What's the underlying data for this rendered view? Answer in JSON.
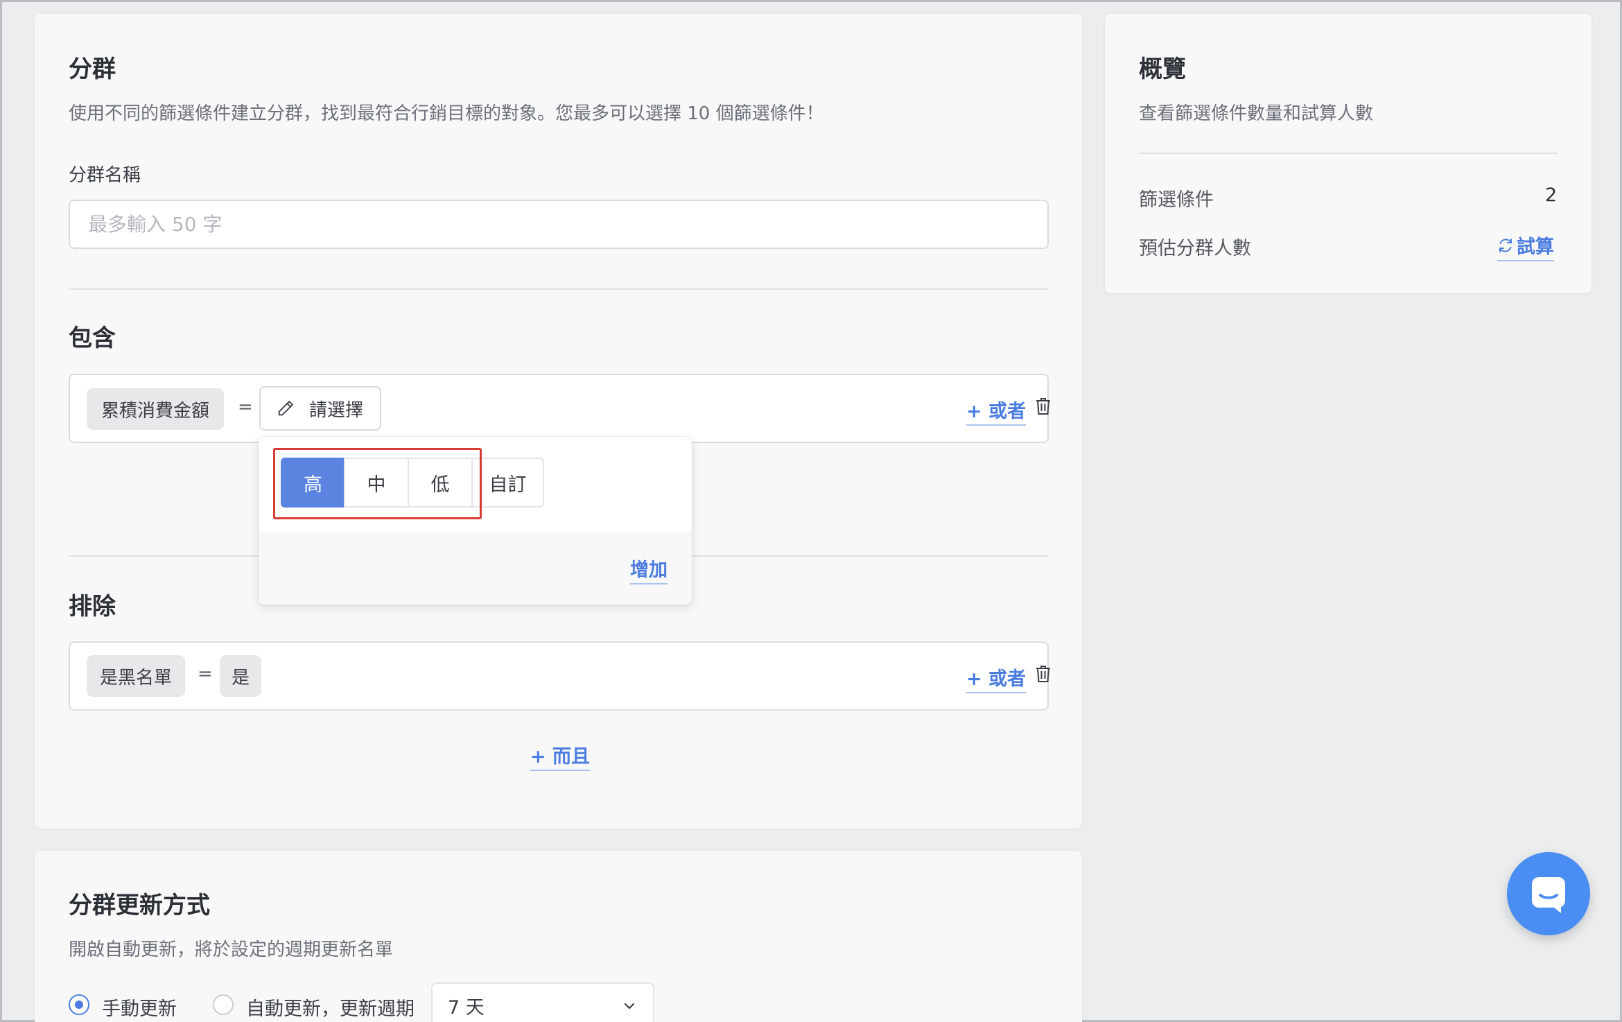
{
  "segment": {
    "title": "分群",
    "description": "使用不同的篩選條件建立分群，找到最符合行銷目標的對象。您最多可以選擇 10 個篩選條件！",
    "name_label": "分群名稱",
    "name_placeholder": "最多輸入 50 字",
    "name_value": ""
  },
  "include": {
    "title": "包含",
    "condition": {
      "field": "累積消費金額",
      "operator": "=",
      "select_label": "請選擇",
      "or_label": "+ 或者"
    },
    "popover": {
      "options": [
        "高",
        "中",
        "低",
        "自訂"
      ],
      "selected": "高",
      "add_label": "增加"
    }
  },
  "exclude": {
    "title": "排除",
    "condition": {
      "field": "是黑名單",
      "operator": "=",
      "value": "是",
      "or_label": "+ 或者"
    }
  },
  "and_label": "+ 而且",
  "overview": {
    "title": "概覽",
    "description": "查看篩選條件數量和試算人數",
    "filter_count_label": "篩選條件",
    "filter_count_value": "2",
    "estimate_label": "預估分群人數",
    "estimate_action": "試算"
  },
  "update": {
    "title": "分群更新方式",
    "description": "開啟自動更新，將於設定的週期更新名單",
    "manual_label": "手動更新",
    "auto_label": "自動更新，更新週期",
    "selected": "manual",
    "period_value": "7 天"
  },
  "colors": {
    "accent": "#4b7de0",
    "segment_active": "#5a84e0",
    "highlight_border": "#d93a32",
    "fab": "#4a8df3"
  },
  "icons": [
    "pencil-icon",
    "trash-icon",
    "refresh-icon",
    "chevron-down-icon",
    "chat-icon"
  ]
}
